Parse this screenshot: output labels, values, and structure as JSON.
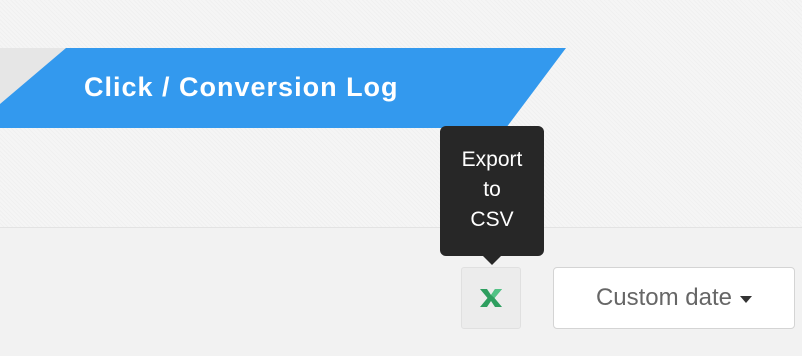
{
  "header": {
    "title": "Click / Conversion Log"
  },
  "tooltip": {
    "lines": [
      "Export",
      "to",
      "CSV"
    ]
  },
  "toolbar": {
    "export_icon": "excel-export-icon",
    "date_filter_label": "Custom date",
    "date_filter_icon": "caret-down-icon"
  },
  "colors": {
    "title_tab": "#3399ee",
    "tooltip_bg": "#272727",
    "export_icon": "#2e9e5f"
  }
}
